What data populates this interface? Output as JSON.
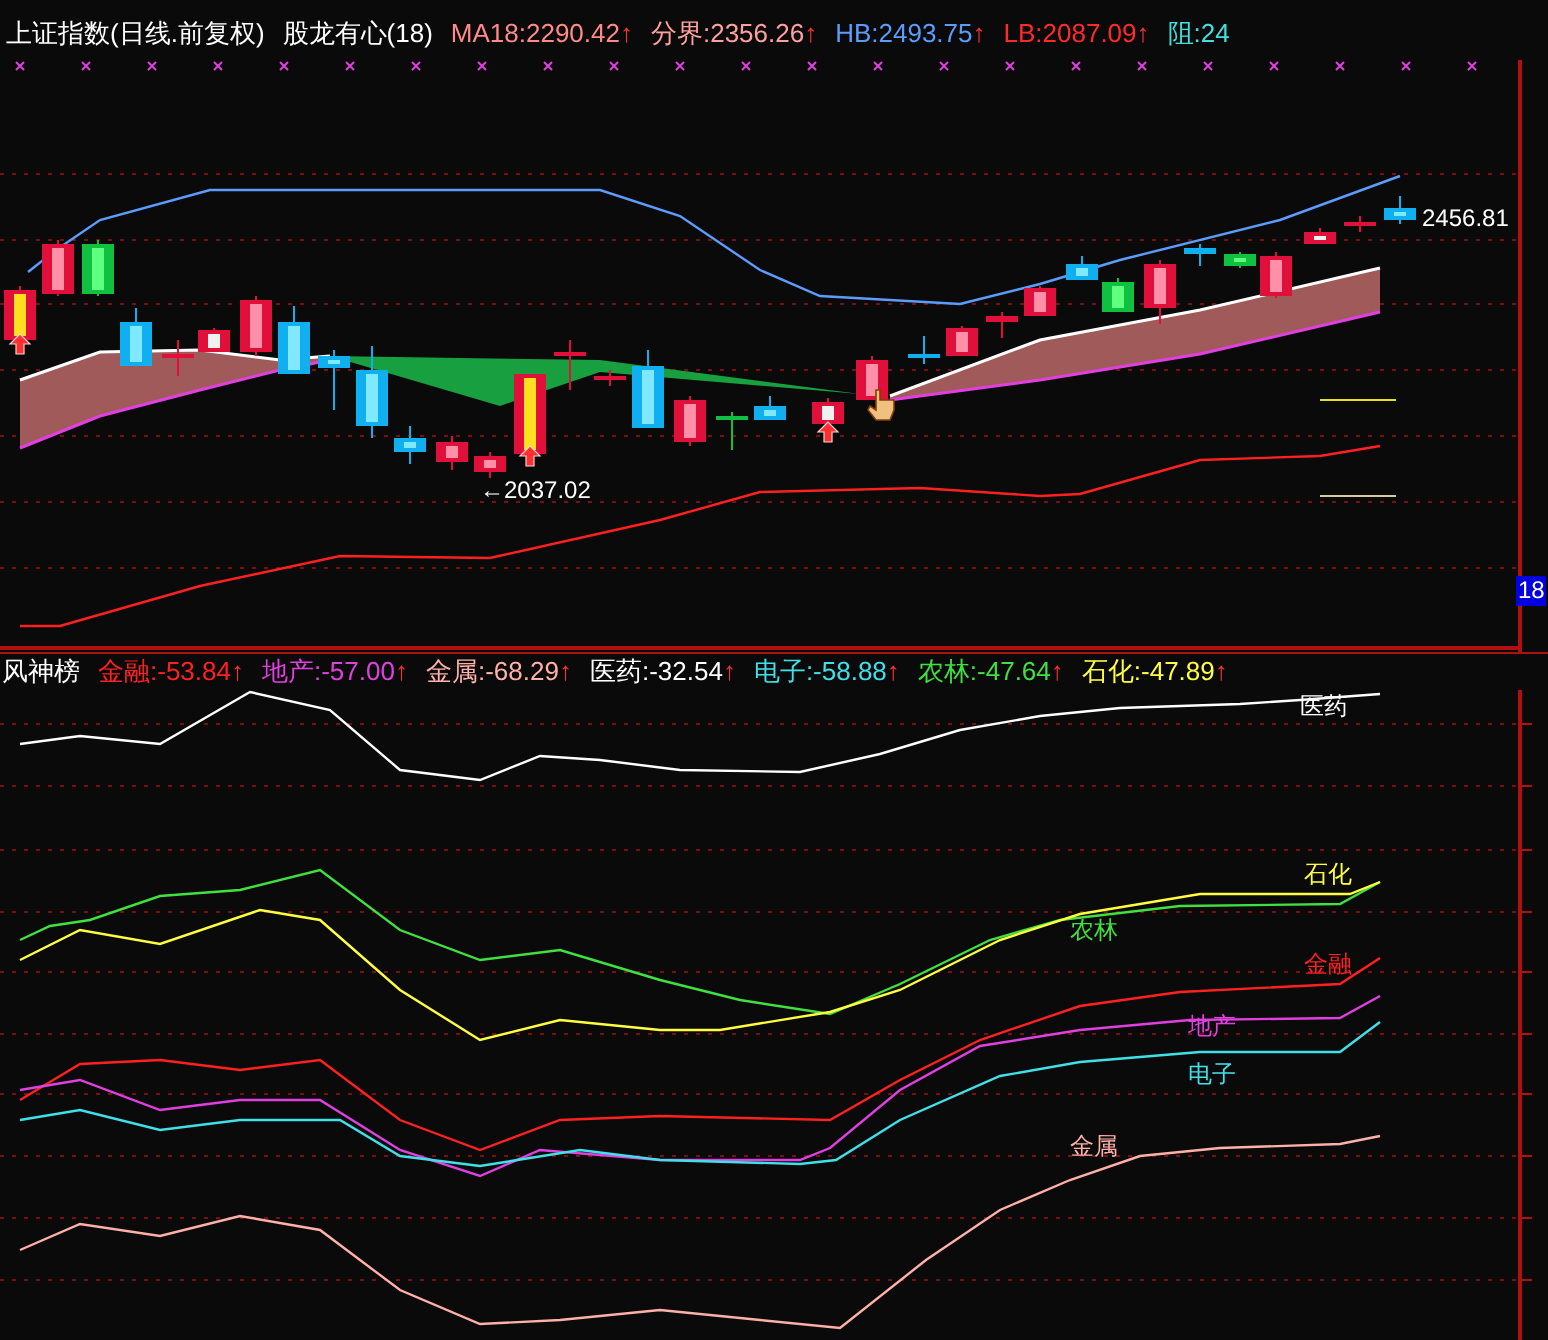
{
  "top_panel": {
    "title": "上证指数(日线.前复权)",
    "indicator": "股龙有心(18)",
    "readings": [
      {
        "label": "MA18:2290.42",
        "arrow": "↑",
        "color": "#ff8a8a"
      },
      {
        "label": "分界:2356.26",
        "arrow": "↑",
        "color": "#ffa0a0"
      },
      {
        "label": "HB:2493.75",
        "arrow": "↑",
        "color": "#5c9cff"
      },
      {
        "label": "LB:2087.09",
        "arrow": "↑",
        "color": "#ff2a2a"
      },
      {
        "label": "阻:24",
        "color": "#40e0e0"
      }
    ],
    "price_labels": [
      {
        "kind": "high",
        "text": "2456.81"
      },
      {
        "kind": "low",
        "text": "←2037.02"
      }
    ],
    "axis_badge": "18"
  },
  "bottom_panel": {
    "title": "风神榜",
    "series": [
      {
        "label": "金融:-53.84",
        "arrow": "↑",
        "color": "#ff2020",
        "curve_label": "金融"
      },
      {
        "label": "地产:-57.00",
        "arrow": "↑",
        "color": "#e040e0",
        "curve_label": "地产"
      },
      {
        "label": "金属:-68.29",
        "arrow": "↑",
        "color": "#ffb0a8",
        "curve_label": "金属"
      },
      {
        "label": "医药:-32.54",
        "arrow": "↑",
        "color": "#ffffff",
        "curve_label": "医药"
      },
      {
        "label": "电子:-58.88",
        "arrow": "↑",
        "color": "#40e0e8",
        "curve_label": "电子"
      },
      {
        "label": "农林:-47.64",
        "arrow": "↑",
        "color": "#40e040",
        "curve_label": "农林"
      },
      {
        "label": "石化:-47.89",
        "arrow": "↑",
        "color": "#ffff40",
        "curve_label": "石化"
      }
    ]
  }
}
